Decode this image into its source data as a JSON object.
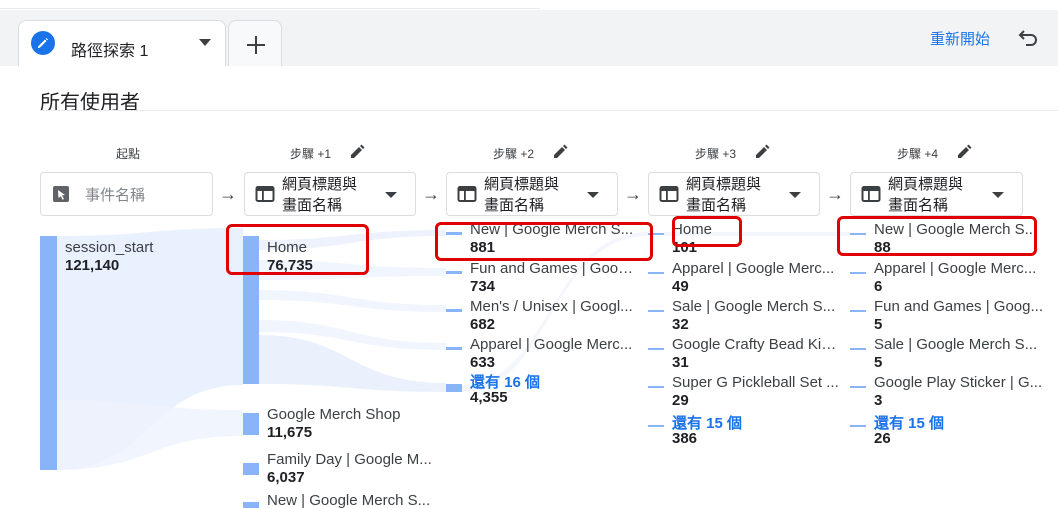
{
  "tab": {
    "label": "路徑探索 1"
  },
  "toolbar": {
    "restart_label": "重新開始"
  },
  "section_title": "所有使用者",
  "start": {
    "label": "起點",
    "placeholder": "事件名稱",
    "node": {
      "label": "session_start",
      "value": "121,140"
    }
  },
  "steps": [
    {
      "label": "步驟 +1",
      "selector": "網頁標題與\n畫面名稱",
      "nodes": [
        {
          "label": "Home",
          "value": "76,735"
        },
        {
          "label": "Google Merch Shop",
          "value": "11,675"
        },
        {
          "label": "Family Day | Google M...",
          "value": "6,037"
        },
        {
          "label": "New | Google Merch S...",
          "value": ""
        }
      ]
    },
    {
      "label": "步驟 +2",
      "selector": "網頁標題與\n畫面名稱",
      "nodes": [
        {
          "label": "New | Google Merch S...",
          "value": "881"
        },
        {
          "label": "Fun and Games | Goog...",
          "value": "734"
        },
        {
          "label": "Men's / Unisex | Googl...",
          "value": "682"
        },
        {
          "label": "Apparel | Google Merc...",
          "value": "633"
        }
      ],
      "more": {
        "label": "還有 16 個",
        "value": "4,355"
      }
    },
    {
      "label": "步驟 +3",
      "selector": "網頁標題與\n畫面名稱",
      "nodes": [
        {
          "label": "Home",
          "value": "101"
        },
        {
          "label": "Apparel | Google Merc...",
          "value": "49"
        },
        {
          "label": "Sale | Google Merch S...",
          "value": "32"
        },
        {
          "label": "Google Crafty Bead Kit ...",
          "value": "31"
        },
        {
          "label": "Super G Pickleball Set ...",
          "value": "29"
        }
      ],
      "more": {
        "label": "還有 15 個",
        "value": "386"
      }
    },
    {
      "label": "步驟 +4",
      "selector": "網頁標題與\n畫面名稱",
      "nodes": [
        {
          "label": "New | Google Merch S...",
          "value": "88"
        },
        {
          "label": "Apparel | Google Merc...",
          "value": "6"
        },
        {
          "label": "Fun and Games | Goog...",
          "value": "5"
        },
        {
          "label": "Sale | Google Merch S...",
          "value": "5"
        },
        {
          "label": "Google Play Sticker | G...",
          "value": "3"
        }
      ],
      "more": {
        "label": "還有 15 個",
        "value": "26"
      }
    }
  ],
  "colors": {
    "accent": "#1a73e8",
    "node_bar": "#8ab4f8",
    "flow": "#e8f0fe",
    "highlight": "#e00000"
  }
}
